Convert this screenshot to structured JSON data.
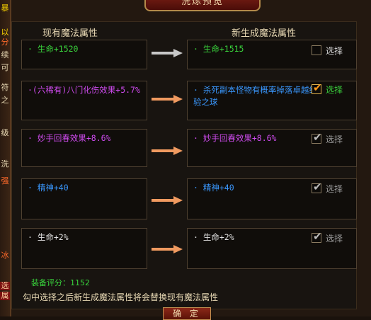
{
  "dialog": {
    "title": "洗炼预览",
    "left_header": "现有魔法属性",
    "right_header": "新生成魔法属性",
    "score_label": "装备评分：1152",
    "hint": "勾中选择之后新生成魔法属性将会替换现有魔法属性",
    "confirm_label": "确 定"
  },
  "left_strip": [
    "暴",
    "以",
    "分",
    "续",
    "可",
    "符",
    "之",
    "级",
    "洗",
    "强",
    "冰",
    "选",
    "属"
  ],
  "rows": [
    {
      "current": "· 生命+1520",
      "current_color": "#39d33c",
      "new": "· 生命+1515",
      "new_color": "#39d33c",
      "select_label": "选择",
      "checked": false,
      "select_state": "empty"
    },
    {
      "current": "·(六稀有)八门化伤效果+5.7%",
      "current_color": "#d04bf0",
      "new": "· 杀死副本怪物有概率掉落卓越经验之球",
      "new_color": "#3a98ff",
      "select_label": "选择",
      "checked": true,
      "select_state": "on"
    },
    {
      "current": "· 妙手回春效果+8.6%",
      "current_color": "#d04bf0",
      "new": "· 妙手回春效果+8.6%",
      "new_color": "#d04bf0",
      "select_label": "选择",
      "checked": true,
      "select_state": "off"
    },
    {
      "current": "· 精神+40",
      "current_color": "#3a98ff",
      "new": "· 精神+40",
      "new_color": "#3a98ff",
      "select_label": "选择",
      "checked": true,
      "select_state": "off"
    },
    {
      "current": "· 生命+2%",
      "current_color": "#e0e0e0",
      "new": "· 生命+2%",
      "new_color": "#e0e0e0",
      "select_label": "选择",
      "checked": true,
      "select_state": "off"
    }
  ]
}
